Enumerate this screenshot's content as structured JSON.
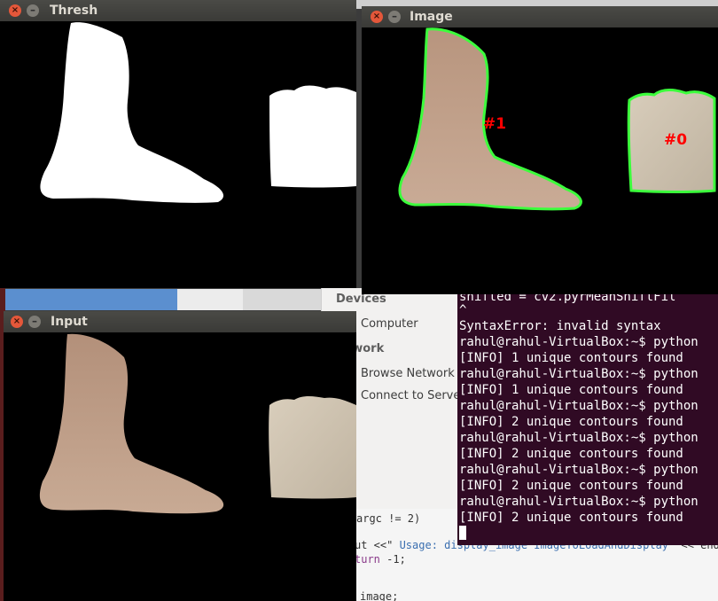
{
  "windows": {
    "thresh": {
      "title": "Thresh"
    },
    "image": {
      "title": "Image",
      "labels": [
        "#1",
        "#0"
      ],
      "outline_color": "#3cff3c",
      "label_color": "#ff0000"
    },
    "input": {
      "title": "Input"
    }
  },
  "window_buttons": {
    "close_icon": "close-icon",
    "min_icon": "minimize-icon",
    "close_glyph": "×",
    "min_glyph": "–"
  },
  "file_manager": {
    "devices": "Devices",
    "computer": "Computer",
    "network": "twork",
    "browse": "Browse Network",
    "connect": "Connect to Serve"
  },
  "editor": {
    "line1": "argc != 2)",
    "line2_a": "ut <<\"",
    "line2_b": " Usage: display_image ImageToLoadAndDisplay\"",
    "line2_c": " << endl;",
    "line3_kw": "turn",
    "line3_rest": " -1;",
    "line4": "image;"
  },
  "terminal": {
    "bg": "#300a24",
    "lines": [
      "  shifted = cv2.pyrMeanShiftFil",
      "         ^",
      "SyntaxError: invalid syntax",
      "rahul@rahul-VirtualBox:~$ python",
      "[INFO] 1 unique contours found",
      "rahul@rahul-VirtualBox:~$ python",
      "[INFO] 1 unique contours found",
      "rahul@rahul-VirtualBox:~$ python",
      "[INFO] 2 unique contours found",
      "rahul@rahul-VirtualBox:~$ python",
      "[INFO] 2 unique contours found",
      "rahul@rahul-VirtualBox:~$ python",
      "[INFO] 2 unique contours found",
      "rahul@rahul-VirtualBox:~$ python",
      "[INFO] 2 unique contours found"
    ]
  }
}
